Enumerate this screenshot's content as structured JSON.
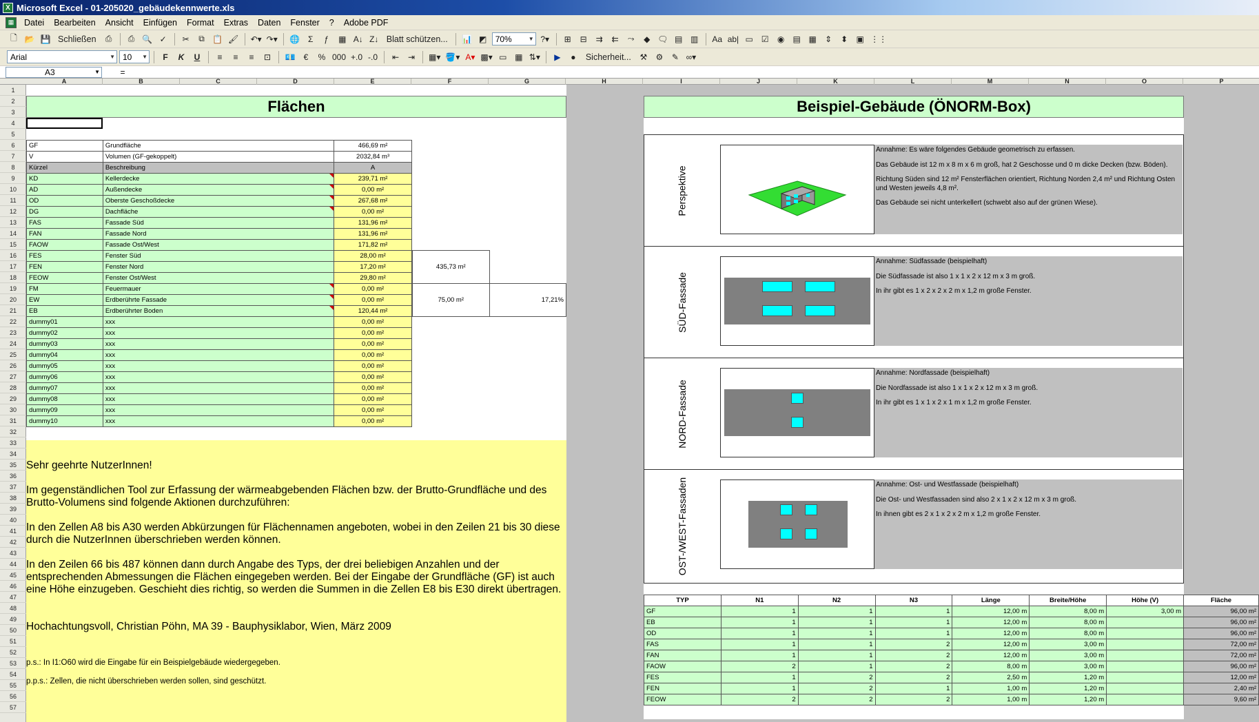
{
  "window": {
    "title": "Microsoft Excel - 01-205020_gebäudekennwerte.xls",
    "app_icon": "excel-icon"
  },
  "menu": [
    "Datei",
    "Bearbeiten",
    "Ansicht",
    "Einfügen",
    "Format",
    "Extras",
    "Daten",
    "Fenster",
    "?",
    "Adobe PDF"
  ],
  "toolbar1": {
    "close_label": "Schließen",
    "protect_label": "Blatt schützen...",
    "zoom": "70%"
  },
  "toolbar2": {
    "font": "Arial",
    "size": "10",
    "bold": "F",
    "italic": "K",
    "underline": "U",
    "security_label": "Sicherheit..."
  },
  "formula": {
    "namebox": "A3",
    "fx": "=",
    "value": ""
  },
  "columns": [
    "A",
    "B",
    "C",
    "D",
    "E",
    "F",
    "G",
    "H",
    "I",
    "J",
    "K",
    "L",
    "M",
    "N",
    "O",
    "P"
  ],
  "rows": [
    "1",
    "2",
    "3",
    "4",
    "5",
    "6",
    "7",
    "8",
    "9",
    "10",
    "11",
    "12",
    "13",
    "14",
    "15",
    "16",
    "17",
    "18",
    "19",
    "20",
    "21",
    "22",
    "23",
    "24",
    "25",
    "26",
    "27",
    "28",
    "29",
    "30",
    "31",
    "32",
    "33",
    "34",
    "35",
    "36",
    "37",
    "38",
    "39",
    "40",
    "41",
    "42",
    "43",
    "44",
    "45",
    "46",
    "47",
    "48",
    "49",
    "50",
    "51",
    "52",
    "53",
    "54",
    "55",
    "56",
    "57"
  ],
  "left": {
    "header": "Flächen",
    "gf": {
      "code": "GF",
      "desc": "Grundfläche",
      "value": "466,69 m²"
    },
    "v": {
      "code": "V",
      "desc": "Volumen (GF-gekoppelt)",
      "value": "2032,84 m³"
    },
    "table_head": {
      "code": "Kürzel",
      "desc": "Beschreibung",
      "value": "A"
    },
    "items": [
      {
        "code": "KD",
        "desc": "Kellerdecke",
        "value": "239,71 m²"
      },
      {
        "code": "AD",
        "desc": "Außendecke",
        "value": "0,00 m²"
      },
      {
        "code": "OD",
        "desc": "Oberste Geschoßdecke",
        "value": "267,68 m²"
      },
      {
        "code": "DG",
        "desc": "Dachfläche",
        "value": "0,00 m²"
      },
      {
        "code": "FAS",
        "desc": "Fassade Süd",
        "value": "131,96 m²"
      },
      {
        "code": "FAN",
        "desc": "Fassade Nord",
        "value": "131,96 m²"
      },
      {
        "code": "FAOW",
        "desc": "Fassade Ost/West",
        "value": "171,82 m²"
      },
      {
        "code": "FES",
        "desc": "Fenster Süd",
        "value": "28,00 m²"
      },
      {
        "code": "FEN",
        "desc": "Fenster Nord",
        "value": "17,20 m²"
      },
      {
        "code": "FEOW",
        "desc": "Fenster Ost/West",
        "value": "29,80 m²"
      },
      {
        "code": "FM",
        "desc": "Feuermauer",
        "value": "0,00 m²"
      },
      {
        "code": "EW",
        "desc": "Erdberührte Fassade",
        "value": "0,00 m²"
      },
      {
        "code": "EB",
        "desc": "Erdberührter Boden",
        "value": "120,44 m²"
      },
      {
        "code": "dummy01",
        "desc": "xxx",
        "value": "0,00 m²"
      },
      {
        "code": "dummy02",
        "desc": "xxx",
        "value": "0,00 m²"
      },
      {
        "code": "dummy03",
        "desc": "xxx",
        "value": "0,00 m²"
      },
      {
        "code": "dummy04",
        "desc": "xxx",
        "value": "0,00 m²"
      },
      {
        "code": "dummy05",
        "desc": "xxx",
        "value": "0,00 m²"
      },
      {
        "code": "dummy06",
        "desc": "xxx",
        "value": "0,00 m²"
      },
      {
        "code": "dummy07",
        "desc": "xxx",
        "value": "0,00 m²"
      },
      {
        "code": "dummy08",
        "desc": "xxx",
        "value": "0,00 m²"
      },
      {
        "code": "dummy09",
        "desc": "xxx",
        "value": "0,00 m²"
      },
      {
        "code": "dummy10",
        "desc": "xxx",
        "value": "0,00 m²"
      }
    ],
    "sum_facade": "435,73 m²",
    "sum_windows": "75,00 m²",
    "ratio": "17,21%",
    "note": {
      "greeting": "Sehr geehrte NutzerInnen!",
      "p1": "Im gegenständlichen Tool zur Erfassung der wärmeabgebenden Flächen bzw. der Brutto-Grundfläche und des Brutto-Volumens sind folgende Aktionen durchzuführen:",
      "p2": "In den Zellen A8 bis A30 werden Abkürzungen für Flächennamen angeboten, wobei in den Zeilen 21 bis 30 diese durch die NutzerInnen überschrieben werden können.",
      "p3": "In den Zeilen 66 bis 487 können dann durch Angabe des Typs, der drei beliebigen Anzahlen und der entsprechenden Abmessungen die Flächen eingegeben werden. Bei der Eingabe der Grundfläche (GF) ist auch eine Höhe einzugeben. Geschieht dies richtig, so werden die Summen in die Zellen E8 bis E30 direkt übertragen.",
      "sign": "Hochachtungsvoll, Christian Pöhn, MA 39 - Bauphysiklabor, Wien, März 2009",
      "ps1": "p.s.: In I1:O60 wird die Eingabe für ein Beispielgebäude wiedergegeben.",
      "ps2": "p.p.s.: Zellen, die nicht überschrieben werden sollen, sind geschützt."
    }
  },
  "right": {
    "header": "Beispiel-Gebäude (ÖNORM-Box)",
    "sections": [
      {
        "label": "Perspektive",
        "lines": [
          "Annahme: Es wäre folgendes Gebäude geometrisch zu erfassen.",
          "Das Gebäude ist 12 m x 8 m x 6 m groß, hat 2 Geschosse und 0 m dicke Decken (bzw. Böden).",
          "Richtung Süden sind 12 m² Fensterflächen orientiert, Richtung Norden 2,4 m² und Richtung Osten und Westen jeweils 4,8 m².",
          "Das Gebäude sei nicht unterkellert (schwebt also auf der grünen Wiese)."
        ]
      },
      {
        "label": "SÜD-Fassade",
        "lines": [
          "Annahme: Südfassade (beispielhaft)",
          "Die Südfassade ist also 1 x 1 x 2 x 12 m x 3 m groß.",
          "In ihr gibt es 1 x 2 x 2 x 2 m x 1,2 m große Fenster."
        ]
      },
      {
        "label": "NORD-Fassade",
        "lines": [
          "Annahme: Nordfassade (beispielhaft)",
          "Die Nordfassade ist also 1 x 1 x 2 x 12 m x 3 m groß.",
          "In ihr gibt es 1 x 1 x 2 x 1 m x 1,2 m große Fenster."
        ]
      },
      {
        "label": "OST-/WEST-Fassaden",
        "lines": [
          "Annahme: Ost- und Westfassade (beispielhaft)",
          "Die Ost- und Westfassaden sind also 2 x 1 x 2 x 12 m x 3 m groß.",
          "In ihnen gibt es 2 x 1 x 2 x 2 m x 1,2 m große Fenster."
        ]
      }
    ],
    "table": {
      "headers": [
        "TYP",
        "N1",
        "N2",
        "N3",
        "Länge",
        "Breite/Höhe",
        "Höhe (V)",
        "Fläche"
      ],
      "rows": [
        [
          "GF",
          "1",
          "1",
          "1",
          "12,00 m",
          "8,00 m",
          "3,00 m",
          "96,00 m²"
        ],
        [
          "EB",
          "1",
          "1",
          "1",
          "12,00 m",
          "8,00 m",
          "",
          "96,00 m²"
        ],
        [
          "OD",
          "1",
          "1",
          "1",
          "12,00 m",
          "8,00 m",
          "",
          "96,00 m²"
        ],
        [
          "FAS",
          "1",
          "1",
          "2",
          "12,00 m",
          "3,00 m",
          "",
          "72,00 m²"
        ],
        [
          "FAN",
          "1",
          "1",
          "2",
          "12,00 m",
          "3,00 m",
          "",
          "72,00 m²"
        ],
        [
          "FAOW",
          "2",
          "1",
          "2",
          "8,00 m",
          "3,00 m",
          "",
          "96,00 m²"
        ],
        [
          "FES",
          "1",
          "2",
          "2",
          "2,50 m",
          "1,20 m",
          "",
          "12,00 m²"
        ],
        [
          "FEN",
          "1",
          "2",
          "1",
          "1,00 m",
          "1,20 m",
          "",
          "2,40 m²"
        ],
        [
          "FEOW",
          "2",
          "2",
          "2",
          "1,00 m",
          "1,20 m",
          "",
          "9,60 m²"
        ]
      ]
    }
  },
  "colors": {
    "header_green": "#ccffcc",
    "value_yellow": "#ffff99",
    "window_cyan": "#00ffff",
    "facade_gray": "#808080",
    "lawn_green": "#33dd33"
  }
}
